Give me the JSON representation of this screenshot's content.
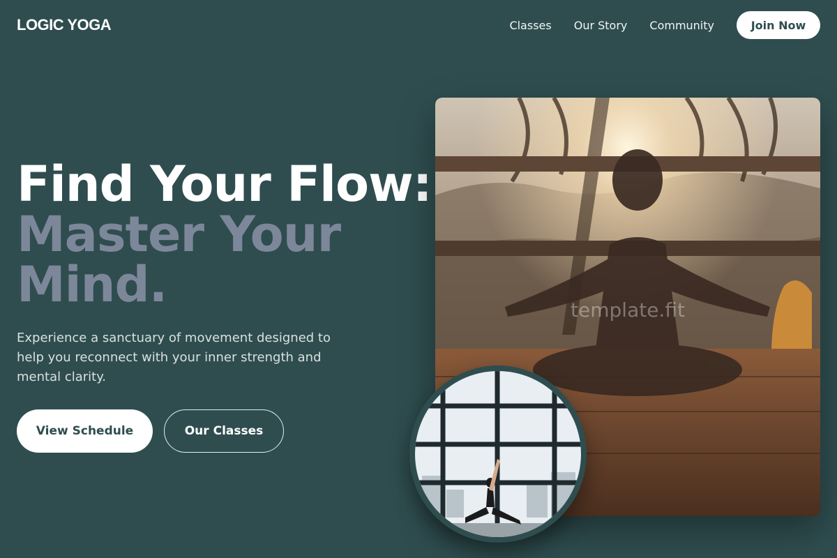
{
  "brand": {
    "logo": "LOGIC YOGA"
  },
  "nav": {
    "links": [
      "Classes",
      "Our Story",
      "Community"
    ],
    "cta": "Join Now"
  },
  "hero": {
    "title_line1": "Find Your Flow:",
    "title_line2": "Master Your Mind.",
    "description": "Experience a sanctuary of movement designed to help you reconnect with your inner strength and mental clarity.",
    "primary_button": "View Schedule",
    "secondary_button": "Our Classes"
  },
  "images": {
    "main_watermark": "template.fit",
    "main_alt": "Woman meditating in lotus pose at sunset with palm trees",
    "circle_alt": "Woman in low lunge yoga pose by large window"
  },
  "colors": {
    "background": "#2f4d4f",
    "accent_muted": "#7d879a",
    "button_fill": "#ffffff"
  }
}
